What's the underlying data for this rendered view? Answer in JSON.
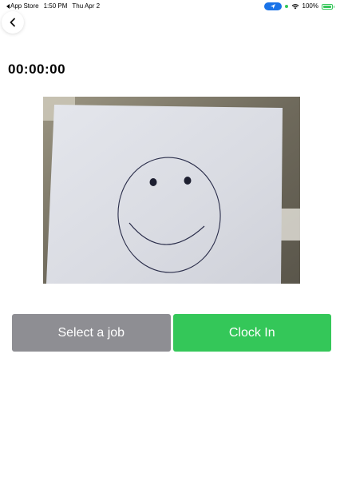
{
  "status_bar": {
    "back_app": "App Store",
    "time": "1:50 PM",
    "date": "Thu Apr 2",
    "battery": "100%",
    "battery_level": 1.0,
    "icons": [
      "location-icon",
      "wifi-icon",
      "battery-icon"
    ]
  },
  "navigation": {
    "back_icon": "chevron-left-icon"
  },
  "timer": {
    "value": "00:00:00"
  },
  "photo": {
    "subject": "smiley-face-drawing"
  },
  "actions": {
    "select_job_label": "Select a job",
    "clock_in_label": "Clock In"
  },
  "colors": {
    "select_job": "#8e8e93",
    "clock_in": "#34c759",
    "location_pill": "#1a73e8"
  }
}
